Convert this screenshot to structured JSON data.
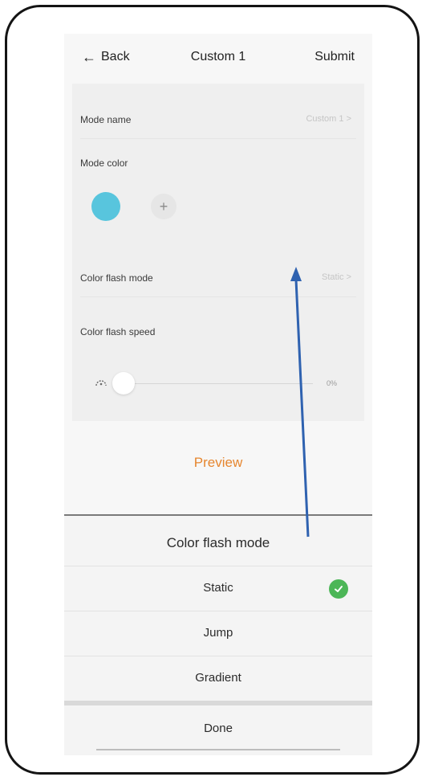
{
  "nav": {
    "back_label": "Back",
    "title": "Custom 1",
    "submit_label": "Submit"
  },
  "mode_name": {
    "label": "Mode name",
    "value": "Custom 1 >"
  },
  "mode_color": {
    "label": "Mode color",
    "swatches": [
      "#58c5dd"
    ],
    "add_symbol": "+"
  },
  "flash_mode": {
    "label": "Color flash mode",
    "value": "Static >"
  },
  "flash_speed": {
    "label": "Color flash speed",
    "percent_label": "0%",
    "value_percent": 0
  },
  "preview": {
    "label": "Preview"
  },
  "sheet": {
    "title": "Color flash mode",
    "options": [
      {
        "label": "Static",
        "selected": true
      },
      {
        "label": "Jump",
        "selected": false
      },
      {
        "label": "Gradient",
        "selected": false
      }
    ],
    "done_label": "Done"
  },
  "colors": {
    "accent": "#e6862f",
    "check": "#4cb657",
    "annotation_arrow": "#2f62b0"
  }
}
